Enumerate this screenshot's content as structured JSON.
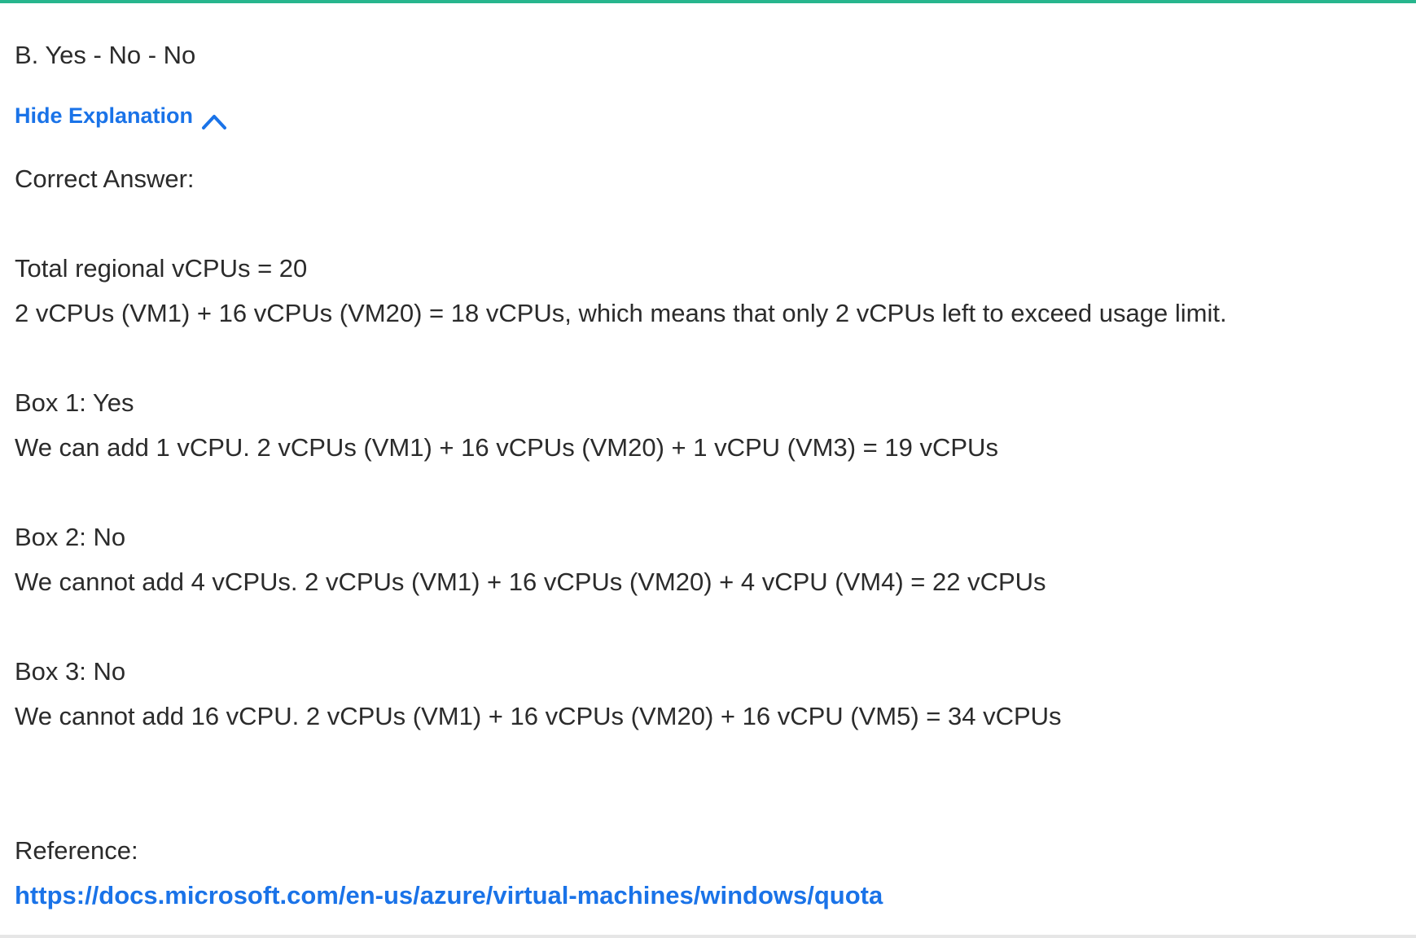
{
  "answer": {
    "selected": "B. Yes - No - No"
  },
  "explanation_toggle": {
    "label": "Hide Explanation",
    "icon": "chevron-up-icon",
    "color": "#1a73e8"
  },
  "explanation": {
    "correct_answer_heading": "Correct Answer:",
    "total_line": "Total regional vCPUs = 20",
    "summary_line": "2 vCPUs (VM1) + 16 vCPUs (VM20) = 18 vCPUs, which means that only 2 vCPUs left to exceed usage limit.",
    "boxes": [
      {
        "heading": "Box 1: Yes",
        "detail": "We can add 1 vCPU. 2 vCPUs (VM1) + 16 vCPUs (VM20) + 1 vCPU (VM3) = 19 vCPUs"
      },
      {
        "heading": "Box 2: No",
        "detail": "We cannot add 4 vCPUs. 2 vCPUs (VM1) + 16 vCPUs (VM20) + 4 vCPU (VM4) = 22 vCPUs"
      },
      {
        "heading": "Box 3: No",
        "detail": "We cannot add 16 vCPU. 2 vCPUs (VM1) + 16 vCPUs (VM20) + 16 vCPU (VM5) = 34 vCPUs"
      }
    ],
    "reference_label": "Reference:",
    "reference_link": "https://docs.microsoft.com/en-us/azure/virtual-machines/windows/quota"
  },
  "colors": {
    "accent_top_border": "#27b58d",
    "link": "#1a73e8",
    "text": "#2b2b2b"
  }
}
